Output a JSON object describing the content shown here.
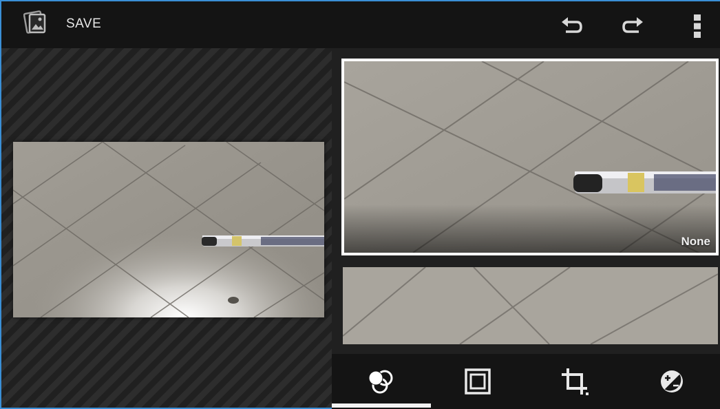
{
  "toolbar": {
    "save_label": "SAVE",
    "app_icon": "gallery-icon",
    "undo_icon": "undo-icon",
    "redo_icon": "redo-icon",
    "overflow_icon": "overflow-menu-icon"
  },
  "filters": {
    "selected_caption": "None"
  },
  "bottom_tabs": [
    {
      "icon": "filters-icon",
      "selected": true
    },
    {
      "icon": "borders-icon",
      "selected": false
    },
    {
      "icon": "crop-icon",
      "selected": false
    },
    {
      "icon": "exposure-icon",
      "selected": false
    }
  ],
  "colors": {
    "accent": "#3a8fd6",
    "toolbar_bg": "#141414",
    "selection": "#ffffff"
  }
}
